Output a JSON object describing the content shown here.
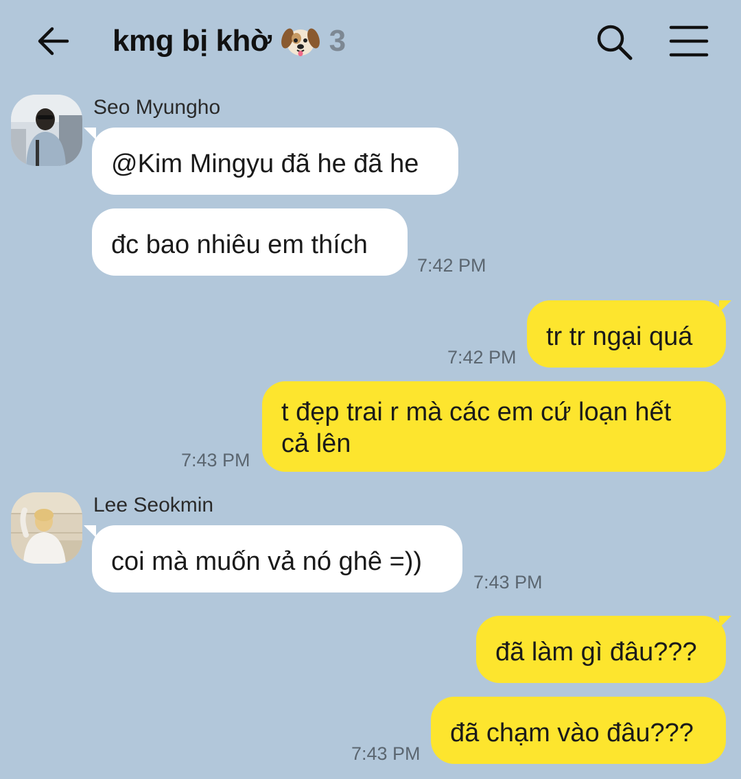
{
  "header": {
    "title": "kmg bị khờ",
    "emoji_icon": "dog-face-icon",
    "member_count": "3",
    "back_icon": "back-arrow-icon",
    "search_icon": "search-icon",
    "menu_icon": "hamburger-menu-icon"
  },
  "colors": {
    "background": "#b2c7da",
    "incoming_bubble": "#ffffff",
    "outgoing_bubble": "#fde52e"
  },
  "messages": [
    {
      "sender": "Seo Myungho",
      "direction": "incoming",
      "text": "@Kim Mingyu đã he đã he"
    },
    {
      "direction": "incoming",
      "text": "đc bao nhiêu em thích",
      "time": "7:42 PM"
    },
    {
      "direction": "outgoing",
      "text": "tr tr ngại quá",
      "time": "7:42 PM"
    },
    {
      "direction": "outgoing",
      "text": "t đẹp trai r mà các em cứ loạn hết cả lên",
      "time": "7:43 PM"
    },
    {
      "sender": "Lee Seokmin",
      "direction": "incoming",
      "text": "coi mà muốn vả nó ghê =))",
      "time": "7:43 PM"
    },
    {
      "direction": "outgoing",
      "text": "đã làm gì đâu???"
    },
    {
      "direction": "outgoing",
      "text": "đã chạm vào đâu???",
      "time": "7:43 PM"
    }
  ]
}
